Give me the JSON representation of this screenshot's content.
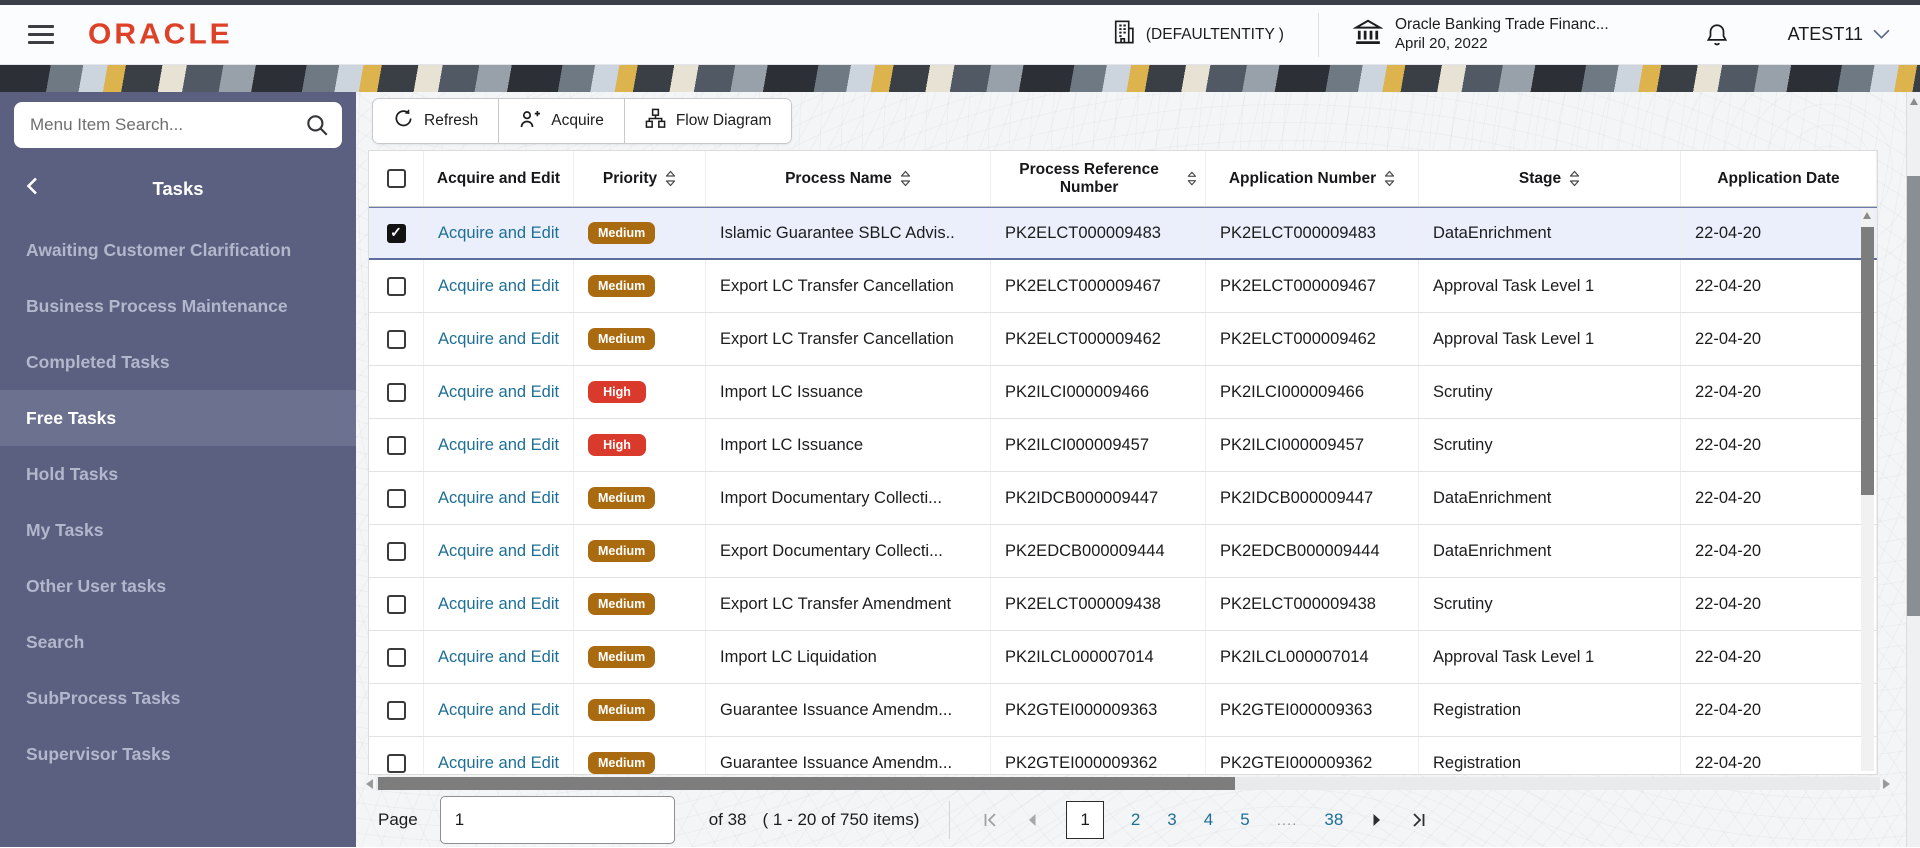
{
  "colors": {
    "brand_red": "#dd4229",
    "link": "#1d6f96",
    "priority": {
      "Medium": "#a96a10",
      "High": "#d93a2b"
    },
    "sidebar_bg": "#5b6080",
    "sidebar_selected_bg": "#6c7190",
    "selected_row_bg": "#eaeffb"
  },
  "header": {
    "brand": "ORACLE",
    "entity_label": "(DEFAULTENTITY )",
    "app_name": "Oracle Banking Trade Financ...",
    "app_date": "April 20, 2022",
    "username": "ATEST11"
  },
  "sidebar": {
    "search_placeholder": "Menu Item Search...",
    "section_title": "Tasks",
    "items": [
      {
        "label": "Awaiting Customer Clarification",
        "selected": false
      },
      {
        "label": "Business Process Maintenance",
        "selected": false
      },
      {
        "label": "Completed Tasks",
        "selected": false
      },
      {
        "label": "Free Tasks",
        "selected": true
      },
      {
        "label": "Hold Tasks",
        "selected": false
      },
      {
        "label": "My Tasks",
        "selected": false
      },
      {
        "label": "Other User tasks",
        "selected": false
      },
      {
        "label": "Search",
        "selected": false
      },
      {
        "label": "SubProcess Tasks",
        "selected": false
      },
      {
        "label": "Supervisor Tasks",
        "selected": false
      }
    ]
  },
  "toolbar": {
    "refresh_label": "Refresh",
    "acquire_label": "Acquire",
    "flow_diagram_label": "Flow Diagram"
  },
  "table": {
    "action_label": "Acquire and Edit",
    "columns": [
      {
        "label": "",
        "sortable": false
      },
      {
        "label": "Acquire and Edit",
        "sortable": false
      },
      {
        "label": "Priority",
        "sortable": true
      },
      {
        "label": "Process Name",
        "sortable": true
      },
      {
        "label": "Process Reference Number",
        "sortable": true
      },
      {
        "label": "Application Number",
        "sortable": true
      },
      {
        "label": "Stage",
        "sortable": true
      },
      {
        "label": "Application Date",
        "sortable": false
      }
    ],
    "rows": [
      {
        "checked": true,
        "priority": "Medium",
        "process_name": "Islamic Guarantee SBLC Advis..",
        "process_ref": "PK2ELCT000009483",
        "application_number": "PK2ELCT000009483",
        "stage": "DataEnrichment",
        "application_date": "22-04-20"
      },
      {
        "checked": false,
        "priority": "Medium",
        "process_name": "Export LC Transfer Cancellation",
        "process_ref": "PK2ELCT000009467",
        "application_number": "PK2ELCT000009467",
        "stage": "Approval Task Level 1",
        "application_date": "22-04-20"
      },
      {
        "checked": false,
        "priority": "Medium",
        "process_name": "Export LC Transfer Cancellation",
        "process_ref": "PK2ELCT000009462",
        "application_number": "PK2ELCT000009462",
        "stage": "Approval Task Level 1",
        "application_date": "22-04-20"
      },
      {
        "checked": false,
        "priority": "High",
        "process_name": "Import LC Issuance",
        "process_ref": "PK2ILCI000009466",
        "application_number": "PK2ILCI000009466",
        "stage": "Scrutiny",
        "application_date": "22-04-20"
      },
      {
        "checked": false,
        "priority": "High",
        "process_name": "Import LC Issuance",
        "process_ref": "PK2ILCI000009457",
        "application_number": "PK2ILCI000009457",
        "stage": "Scrutiny",
        "application_date": "22-04-20"
      },
      {
        "checked": false,
        "priority": "Medium",
        "process_name": "Import Documentary Collecti...",
        "process_ref": "PK2IDCB000009447",
        "application_number": "PK2IDCB000009447",
        "stage": "DataEnrichment",
        "application_date": "22-04-20"
      },
      {
        "checked": false,
        "priority": "Medium",
        "process_name": "Export Documentary Collecti...",
        "process_ref": "PK2EDCB000009444",
        "application_number": "PK2EDCB000009444",
        "stage": "DataEnrichment",
        "application_date": "22-04-20"
      },
      {
        "checked": false,
        "priority": "Medium",
        "process_name": "Export LC Transfer Amendment",
        "process_ref": "PK2ELCT000009438",
        "application_number": "PK2ELCT000009438",
        "stage": "Scrutiny",
        "application_date": "22-04-20"
      },
      {
        "checked": false,
        "priority": "Medium",
        "process_name": "Import LC Liquidation",
        "process_ref": "PK2ILCL000007014",
        "application_number": "PK2ILCL000007014",
        "stage": "Approval Task Level 1",
        "application_date": "22-04-20"
      },
      {
        "checked": false,
        "priority": "Medium",
        "process_name": "Guarantee Issuance Amendm...",
        "process_ref": "PK2GTEI000009363",
        "application_number": "PK2GTEI000009363",
        "stage": "Registration",
        "application_date": "22-04-20"
      },
      {
        "checked": false,
        "priority": "Medium",
        "process_name": "Guarantee Issuance Amendm...",
        "process_ref": "PK2GTEI000009362",
        "application_number": "PK2GTEI000009362",
        "stage": "Registration",
        "application_date": "22-04-20"
      }
    ]
  },
  "pagination": {
    "page_label": "Page",
    "page_input_value": "1",
    "total_text": "of 38",
    "items_text": "( 1 - 20 of 750 items)",
    "pages": [
      "1",
      "2",
      "3",
      "4",
      "5",
      "....",
      "38"
    ],
    "current_page": "1"
  }
}
